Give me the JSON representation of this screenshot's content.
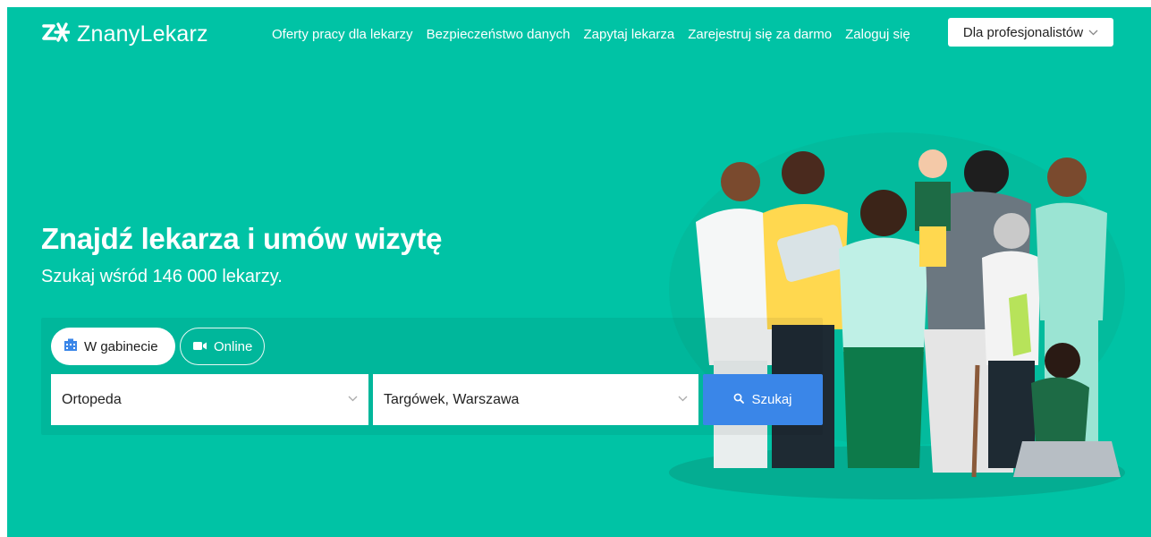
{
  "header": {
    "logo_text": "ZnanyLekarz",
    "nav": [
      "Oferty pracy dla lekarzy",
      "Bezpieczeństwo danych",
      "Zapytaj lekarza",
      "Zarejestruj się za darmo",
      "Zaloguj się"
    ],
    "pro_button": "Dla profesjonalistów"
  },
  "hero": {
    "title": "Znajdź lekarza i umów wizytę",
    "subtitle": "Szukaj wśród 146 000 lekarzy."
  },
  "search": {
    "tabs": [
      {
        "label": "W gabinecie",
        "icon": "building-icon",
        "active": true
      },
      {
        "label": "Online",
        "icon": "video-camera-icon",
        "active": false
      }
    ],
    "specialization_value": "Ortopeda",
    "location_value": "Targówek, Warszawa",
    "submit_label": "Szukaj"
  },
  "colors": {
    "brand": "#00c3a5",
    "button": "#3a86e8"
  }
}
